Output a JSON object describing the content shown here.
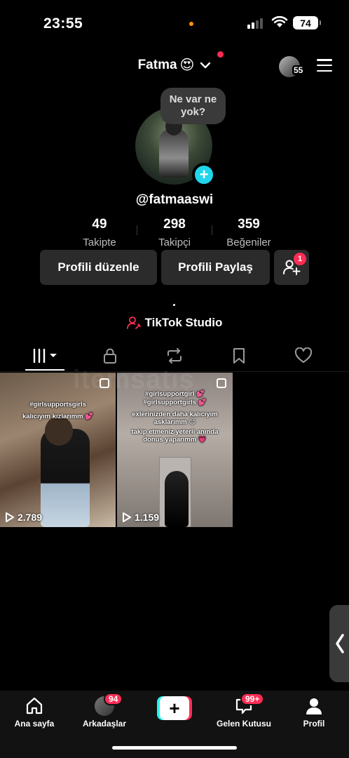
{
  "status_bar": {
    "time": "23:55",
    "battery": "74"
  },
  "header": {
    "username": "Fatma",
    "emoji": "😍",
    "following_avatar_count": "55"
  },
  "profile": {
    "bubble_text": "Ne var ne yok?",
    "handle": "@fatmaaswi"
  },
  "stats": [
    {
      "value": "49",
      "label": "Takipte"
    },
    {
      "value": "298",
      "label": "Takipçi"
    },
    {
      "value": "359",
      "label": "Beğeniler"
    }
  ],
  "buttons": {
    "edit": "Profili düzenle",
    "share": "Profili Paylaş",
    "add_friend_badge": "1"
  },
  "studio": {
    "label": "TikTok Studio"
  },
  "tabs": [
    "videos-icon",
    "lock-icon",
    "repost-icon",
    "bookmark-icon",
    "heart-icon"
  ],
  "watermark": "itemsatış",
  "videos": [
    {
      "caption_line1": "#girlsupportsgirls",
      "caption_line2": "kalıcıyım kızlarımm 💕",
      "views": "2.789"
    },
    {
      "caption_line1": "#girlsupportgirl 💕",
      "caption_line2": "#girlsupportgirls 💕",
      "caption_line3": "exlerinizden daha kalıcıyım asklarımm 😊",
      "caption_line4": "takip etmeniz yeterli anında donus yaparımm 💗",
      "views": "1.159"
    }
  ],
  "bottom_nav": {
    "home": "Ana sayfa",
    "friends": "Arkadaşlar",
    "friends_badge": "94",
    "inbox": "Gelen Kutusu",
    "inbox_badge": "99+",
    "profile": "Profil"
  },
  "colors": {
    "accent_red": "#fe2c55",
    "accent_cyan": "#20d5ec",
    "button_bg": "#2b2b2b"
  }
}
